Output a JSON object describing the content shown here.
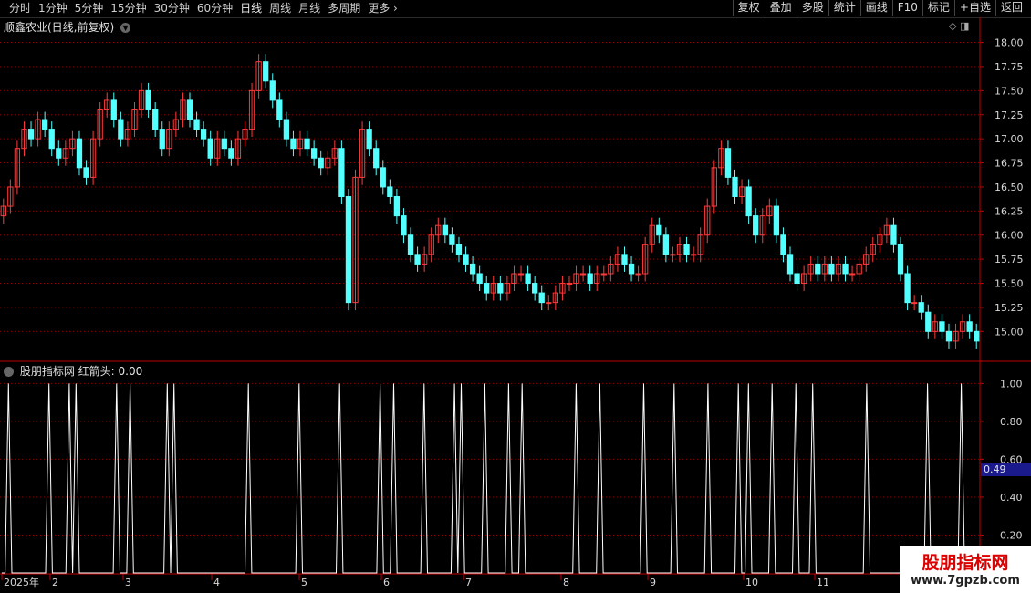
{
  "toolbar": {
    "tabs": [
      "分时",
      "1分钟",
      "5分钟",
      "15分钟",
      "30分钟",
      "60分钟",
      "日线",
      "周线",
      "月线",
      "多周期",
      "更多"
    ],
    "active_tab": "日线",
    "right_buttons": [
      "复权",
      "叠加",
      "多股",
      "统计",
      "画线",
      "F10",
      "标记",
      "+自选",
      "返回"
    ]
  },
  "main_title": "顺鑫农业(日线,前复权)",
  "indicator": {
    "name": "股朋指标网",
    "label": "红箭头:",
    "value": "0.00",
    "current_axis_value": "0.49"
  },
  "watermark": {
    "line1": "股朋指标网",
    "line2": "www.7gpzb.com"
  },
  "colors": {
    "up": "#ff3a3a",
    "down": "#54ffff",
    "grid": "#8b0000",
    "axis": "#c00000",
    "line": "#ffffff"
  },
  "chart_data": [
    {
      "type": "candlestick",
      "title": "顺鑫农业(日线,前复权)",
      "ylim": [
        14.7,
        18.1
      ],
      "yticks": [
        15.0,
        15.25,
        15.5,
        15.75,
        16.0,
        16.25,
        16.5,
        16.75,
        17.0,
        17.25,
        17.5,
        17.75,
        18.0
      ],
      "ytick_labels": [
        "15.00",
        "15.25",
        "15.50",
        "15.75",
        "16.00",
        "16.25",
        "16.50",
        "16.75",
        "17.00",
        "17.25",
        "17.50",
        "17.75",
        "18.00"
      ],
      "xtick_labels": [
        "2025年",
        "2",
        "3",
        "4",
        "5",
        "6",
        "7",
        "8",
        "9",
        "10",
        "11"
      ],
      "closes": [
        16.3,
        16.5,
        16.9,
        17.1,
        17.0,
        17.2,
        17.1,
        16.9,
        16.8,
        16.9,
        17.0,
        16.7,
        16.6,
        17.0,
        17.3,
        17.4,
        17.2,
        17.0,
        17.1,
        17.3,
        17.5,
        17.3,
        17.1,
        16.9,
        17.1,
        17.2,
        17.4,
        17.2,
        17.1,
        17.0,
        16.8,
        17.0,
        16.9,
        16.8,
        17.0,
        17.1,
        17.5,
        17.8,
        17.6,
        17.4,
        17.2,
        17.0,
        16.9,
        17.0,
        16.9,
        16.8,
        16.7,
        16.8,
        16.9,
        16.4,
        15.3,
        16.6,
        17.1,
        16.9,
        16.7,
        16.5,
        16.4,
        16.2,
        16.0,
        15.8,
        15.7,
        15.8,
        16.0,
        16.1,
        16.0,
        15.9,
        15.8,
        15.7,
        15.6,
        15.5,
        15.4,
        15.5,
        15.4,
        15.5,
        15.6,
        15.6,
        15.5,
        15.4,
        15.3,
        15.3,
        15.4,
        15.5,
        15.5,
        15.6,
        15.6,
        15.5,
        15.6,
        15.6,
        15.7,
        15.8,
        15.7,
        15.6,
        15.6,
        15.9,
        16.1,
        16.0,
        15.8,
        15.8,
        15.9,
        15.8,
        15.8,
        16.0,
        16.3,
        16.7,
        16.9,
        16.6,
        16.4,
        16.5,
        16.2,
        16.0,
        16.2,
        16.3,
        16.0,
        15.8,
        15.6,
        15.5,
        15.6,
        15.7,
        15.6,
        15.7,
        15.6,
        15.7,
        15.6,
        15.6,
        15.7,
        15.8,
        15.9,
        16.0,
        16.1,
        15.9,
        15.6,
        15.3,
        15.3,
        15.2,
        15.0,
        15.1,
        15.0,
        14.9,
        15.0,
        15.1,
        15.0,
        14.9
      ],
      "highs_lows_note": ""
    },
    {
      "type": "line",
      "name": "红箭头",
      "ylim": [
        0,
        1.05
      ],
      "yticks": [
        0.2,
        0.4,
        0.6,
        0.8,
        1.0
      ],
      "ytick_labels": [
        "0.20",
        "0.40",
        "0.60",
        "0.80",
        "1.00"
      ],
      "spike_positions": [
        2,
        14,
        20,
        22,
        34,
        38,
        49,
        51,
        73,
        88,
        100,
        112,
        116,
        125,
        134,
        136,
        143,
        150,
        154,
        170,
        177,
        190,
        199,
        209,
        218,
        221,
        228,
        235,
        240,
        256,
        274,
        284
      ]
    }
  ]
}
